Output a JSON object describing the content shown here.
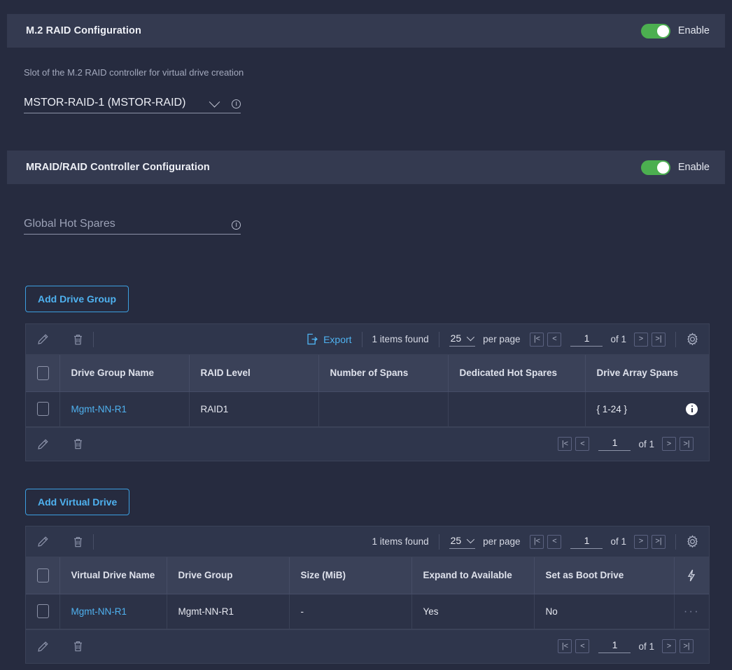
{
  "sections": [
    {
      "title": "M.2 RAID Configuration",
      "toggle_label": "Enable",
      "toggle_on": true,
      "field_label": "Slot of the M.2 RAID controller for virtual drive creation",
      "field_value": "MSTOR-RAID-1 (MSTOR-RAID)"
    },
    {
      "title": "MRAID/RAID Controller Configuration",
      "toggle_label": "Enable",
      "toggle_on": true,
      "field_placeholder": "Global Hot Spares"
    }
  ],
  "buttons": {
    "add_drive_group": "Add Drive Group",
    "add_virtual_drive": "Add Virtual Drive"
  },
  "drive_group_table": {
    "toolbar": {
      "export_label": "Export",
      "items_found": "1 items found",
      "per_page_value": "25",
      "per_page_label": "per page",
      "page_value": "1",
      "page_of": "of 1",
      "first_label": "|<",
      "prev_label": "<",
      "next_label": ">",
      "last_label": ">|"
    },
    "columns": [
      "Drive Group Name",
      "RAID Level",
      "Number of Spans",
      "Dedicated Hot Spares",
      "Drive Array Spans"
    ],
    "rows": [
      {
        "drive_group_name": "Mgmt-NN-R1",
        "raid_level": "RAID1",
        "number_of_spans": "",
        "dedicated_hot_spares": "",
        "drive_array_spans": "{ 1-24 }"
      }
    ],
    "footer": {
      "page_value": "1",
      "page_of": "of 1",
      "first_label": "|<",
      "prev_label": "<",
      "next_label": ">",
      "last_label": ">|"
    }
  },
  "virtual_drive_table": {
    "toolbar": {
      "items_found": "1 items found",
      "per_page_value": "25",
      "per_page_label": "per page",
      "page_value": "1",
      "page_of": "of 1",
      "first_label": "|<",
      "prev_label": "<",
      "next_label": ">",
      "last_label": ">|"
    },
    "columns": [
      "Virtual Drive Name",
      "Drive Group",
      "Size (MiB)",
      "Expand to Available",
      "Set as Boot Drive"
    ],
    "rows": [
      {
        "virtual_drive_name": "Mgmt-NN-R1",
        "drive_group": "Mgmt-NN-R1",
        "size_mib": "-",
        "expand_to_available": "Yes",
        "set_as_boot_drive": "No",
        "actions": "···"
      }
    ],
    "footer": {
      "page_value": "1",
      "page_of": "of 1",
      "first_label": "|<",
      "prev_label": "<",
      "next_label": ">",
      "last_label": ">|"
    }
  },
  "colors": {
    "page_bg": "#262b3f",
    "panel_header_bg": "#343a50",
    "accent_link": "#4fb2f0",
    "toggle_on": "#4caf50",
    "table_header_bg": "#3a4158"
  }
}
